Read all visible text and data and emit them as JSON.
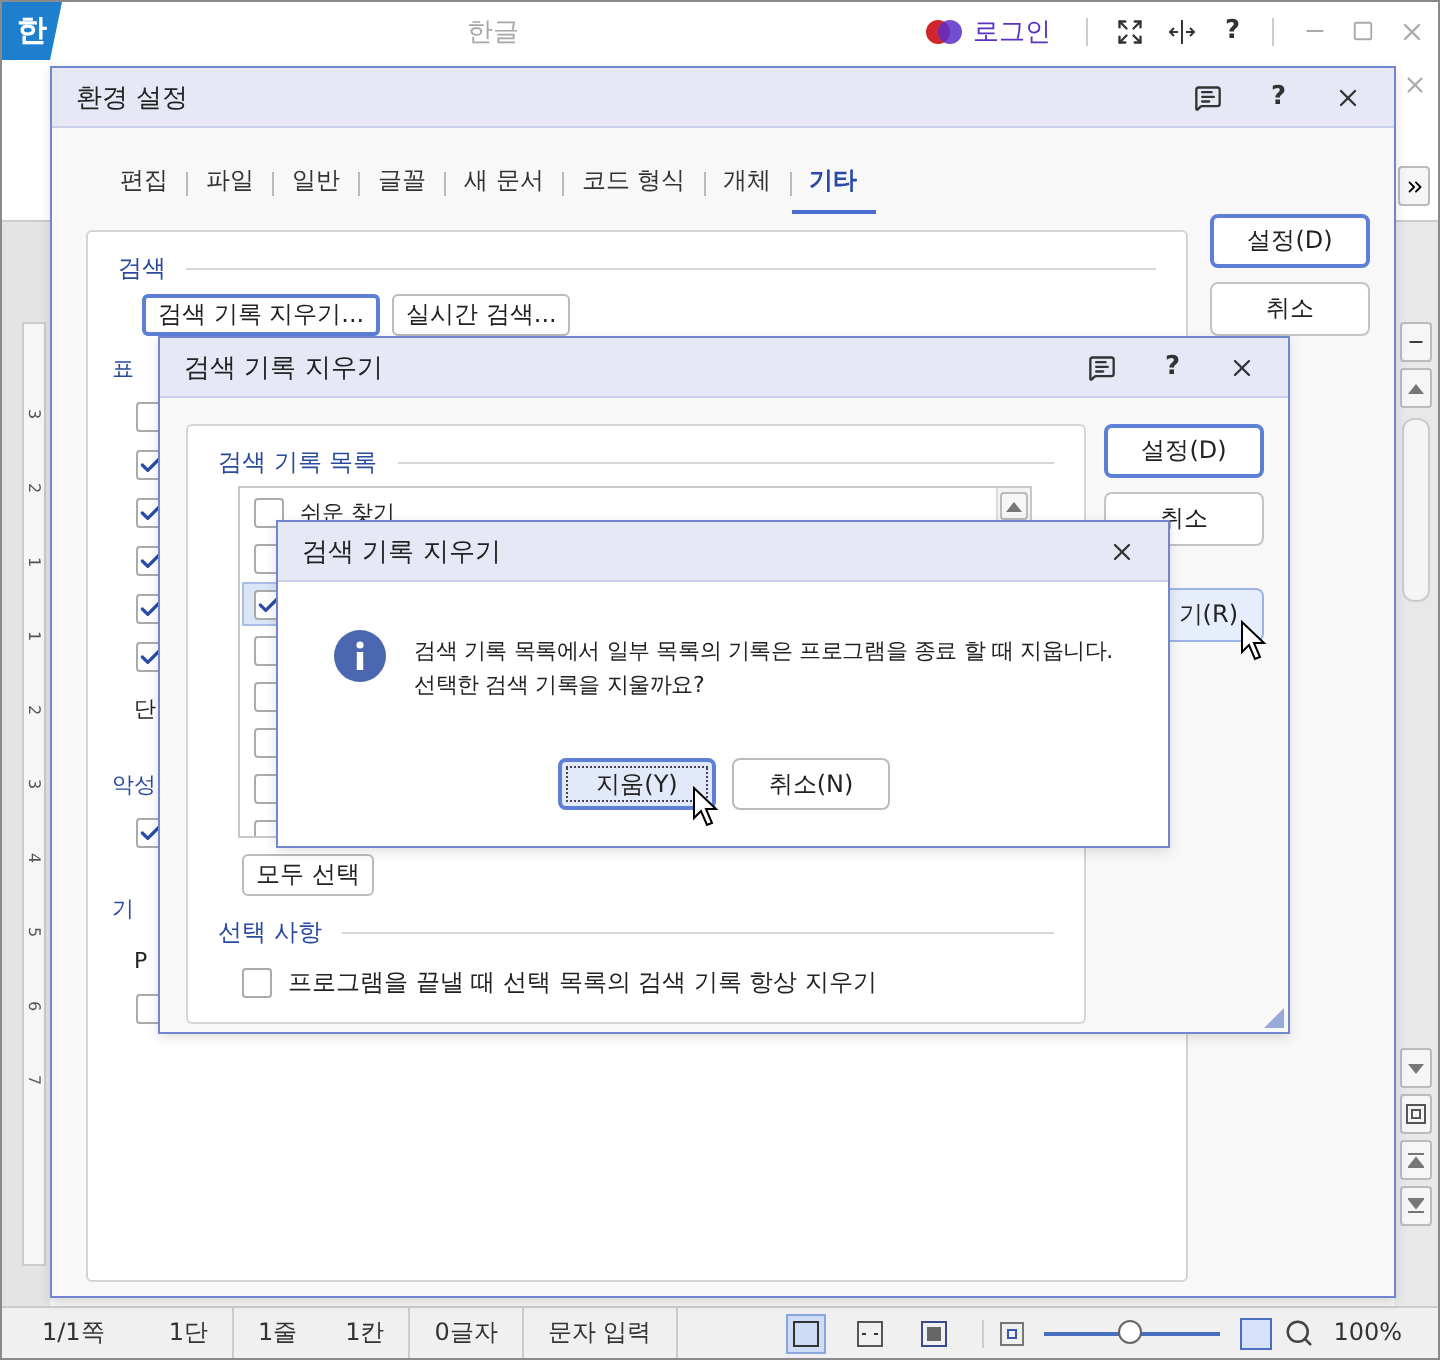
{
  "app": {
    "logo": "한",
    "title": "한글",
    "login": "로그인",
    "help": "?"
  },
  "ruler": [
    "3",
    "2",
    "1",
    "1",
    "2",
    "3",
    "4",
    "5",
    "6",
    "7"
  ],
  "settings_dialog": {
    "title": "환경 설정",
    "help": "?",
    "tabs": [
      {
        "label": "편집",
        "selected": false
      },
      {
        "label": "파일",
        "selected": false
      },
      {
        "label": "일반",
        "selected": false
      },
      {
        "label": "글꼴",
        "selected": false
      },
      {
        "label": "새 문서",
        "selected": false
      },
      {
        "label": "코드 형식",
        "selected": false
      },
      {
        "label": "개체",
        "selected": false
      },
      {
        "label": "기타",
        "selected": true
      }
    ],
    "buttons": [
      {
        "label": "설정(D)",
        "default": true
      },
      {
        "label": "취소",
        "default": false
      }
    ],
    "search_section": {
      "title": "검색",
      "buttons": [
        {
          "label": "검색 기록 지우기...",
          "focused": true
        },
        {
          "label": "실시간 검색...",
          "focused": false
        }
      ]
    },
    "rows": [
      {
        "kind": "heading",
        "text": "표"
      },
      {
        "kind": "checkbox",
        "checked": false
      },
      {
        "kind": "checkbox",
        "checked": true
      },
      {
        "kind": "checkbox",
        "checked": true
      },
      {
        "kind": "checkbox",
        "checked": true
      },
      {
        "kind": "checkbox",
        "checked": true
      },
      {
        "kind": "checkbox",
        "checked": true
      },
      {
        "kind": "text",
        "text": "단"
      },
      {
        "kind": "heading",
        "text": "악성"
      },
      {
        "kind": "checkbox",
        "checked": true
      },
      {
        "kind": "heading",
        "text": "기"
      },
      {
        "kind": "text",
        "text": "P"
      },
      {
        "kind": "checkbox",
        "checked": false
      }
    ]
  },
  "history_dialog": {
    "title": "검색 기록 지우기",
    "help": "?",
    "list_title": "검색 기록 목록",
    "items": [
      {
        "label": "쉬운 찾기",
        "checked": false,
        "selected": false
      },
      {
        "checked": false,
        "selected": false
      },
      {
        "checked": true,
        "selected": true
      },
      {
        "checked": false,
        "selected": false
      },
      {
        "checked": false,
        "selected": false
      },
      {
        "checked": false,
        "selected": false
      },
      {
        "checked": false,
        "selected": false
      },
      {
        "checked": false,
        "selected": false
      }
    ],
    "select_all": "모두 선택",
    "options_title": "선택 사항",
    "option": {
      "label": "프로그램을 끝낼 때 선택 목록의 검색 기록 항상 지우기",
      "checked": false
    },
    "buttons": [
      {
        "label": "설정(D)",
        "focused": true,
        "hover": false
      },
      {
        "label": "취소",
        "focused": false,
        "hover": false
      },
      {
        "label": "기(R)",
        "focused": false,
        "hover": true
      }
    ]
  },
  "confirm_dialog": {
    "title": "검색 기록 지우기",
    "message": [
      "검색 기록 목록에서 일부 목록의 기록은 프로그램을 종료 할 때 지웁니다.",
      "선택한 검색 기록을 지울까요?"
    ],
    "buttons": [
      {
        "label": "지움(Y)",
        "default": true
      },
      {
        "label": "취소(N)",
        "default": false
      }
    ]
  },
  "status_bar": {
    "items": [
      "1/1쪽",
      "1단",
      "1줄",
      "1칸",
      "0글자",
      "문자 입력"
    ],
    "views": [
      {
        "kind": "page",
        "selected": true
      },
      {
        "kind": "width",
        "selected": false
      },
      {
        "kind": "full",
        "selected": false
      }
    ],
    "level": 0.5,
    "zoom": "100%"
  }
}
